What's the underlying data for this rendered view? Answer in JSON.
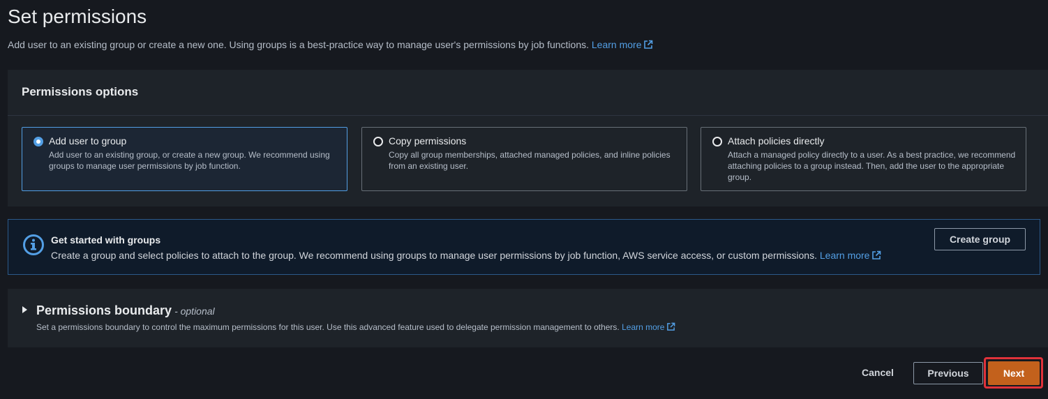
{
  "header": {
    "title": "Set permissions",
    "subtitle": "Add user to an existing group or create a new one. Using groups is a best-practice way to manage user's permissions by job functions.",
    "learn_more": "Learn more"
  },
  "permissions_options": {
    "heading": "Permissions options",
    "selected": "add-user-to-group",
    "options": [
      {
        "label": "Add user to group",
        "description": "Add user to an existing group, or create a new group. We recommend using groups to manage user permissions by job function."
      },
      {
        "label": "Copy permissions",
        "description": "Copy all group memberships, attached managed policies, and inline policies from an existing user."
      },
      {
        "label": "Attach policies directly",
        "description": "Attach a managed policy directly to a user. As a best practice, we recommend attaching policies to a group instead. Then, add the user to the appropriate group."
      }
    ]
  },
  "info_alert": {
    "heading": "Get started with groups",
    "body": "Create a group and select policies to attach to the group. We recommend using groups to manage user permissions by job function, AWS service access, or custom permissions.",
    "learn_more": "Learn more",
    "button_label": "Create group"
  },
  "permissions_boundary": {
    "heading": "Permissions boundary",
    "optional": "- optional",
    "description": "Set a permissions boundary to control the maximum permissions for this user. Use this advanced feature used to delegate permission management to others.",
    "learn_more": "Learn more"
  },
  "footer": {
    "cancel_label": "Cancel",
    "previous_label": "Previous",
    "next_label": "Next"
  },
  "colors": {
    "background": "#16191f",
    "panel": "#1e2329",
    "link": "#539fe5",
    "primary_button": "#c3611c",
    "highlight_border": "#e0323a"
  }
}
